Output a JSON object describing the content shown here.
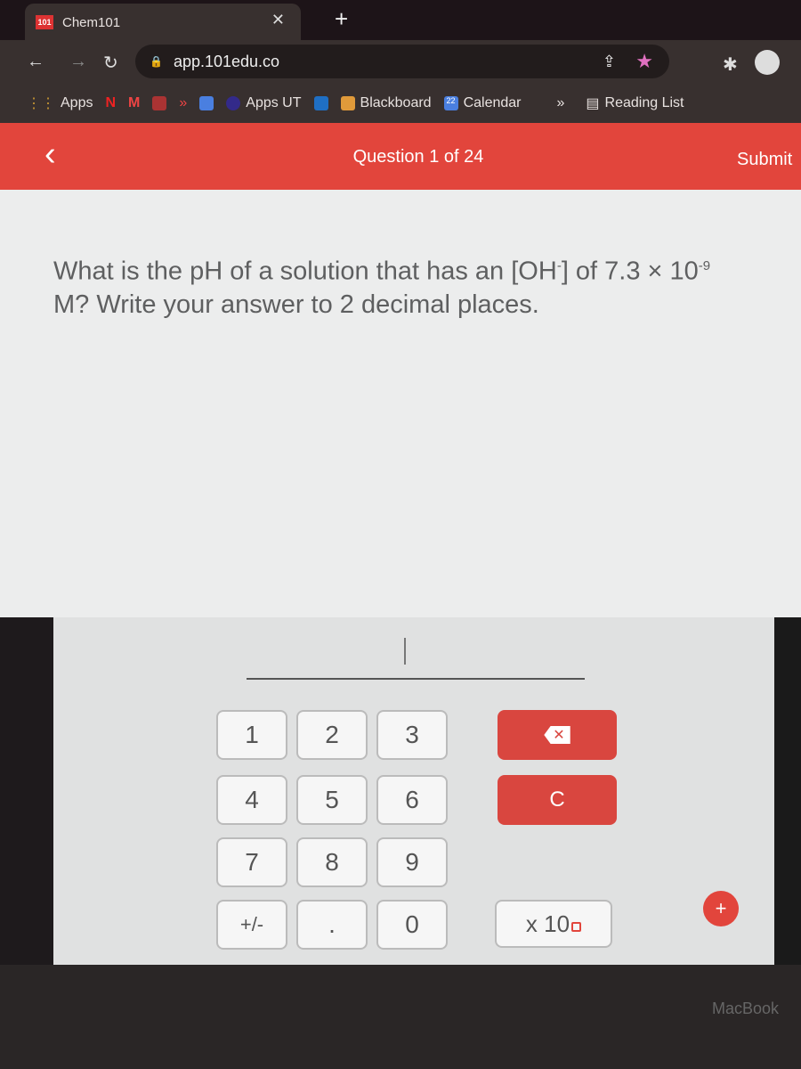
{
  "browser": {
    "tab_title": "Chem101",
    "tab_favicon": "101",
    "url": "app.101edu.co",
    "bookmarks": [
      {
        "label": "Apps"
      },
      {
        "label": "Apps UT"
      },
      {
        "label": "Blackboard"
      },
      {
        "label": "Calendar"
      },
      {
        "label": "Reading List"
      }
    ],
    "calendar_icon_num": "22",
    "more": "»"
  },
  "header": {
    "question_count": "Question 1 of 24",
    "submit": "Submit",
    "accent": "#e2453c"
  },
  "question": {
    "line1": "What is the pH of a solution that has an [OH",
    "sup_minus": "-",
    "mid": "] of 7.3 × 10",
    "exponent": "-9",
    "line2": "M? Write your answer to 2 decimal places."
  },
  "answer": {
    "value": ""
  },
  "keypad": {
    "keys": [
      "1",
      "2",
      "3",
      "4",
      "5",
      "6",
      "7",
      "8",
      "9",
      "+/-",
      ".",
      "0"
    ],
    "clear": "C",
    "x10": "x 10"
  },
  "bezel": {
    "brand": "MacBook"
  }
}
